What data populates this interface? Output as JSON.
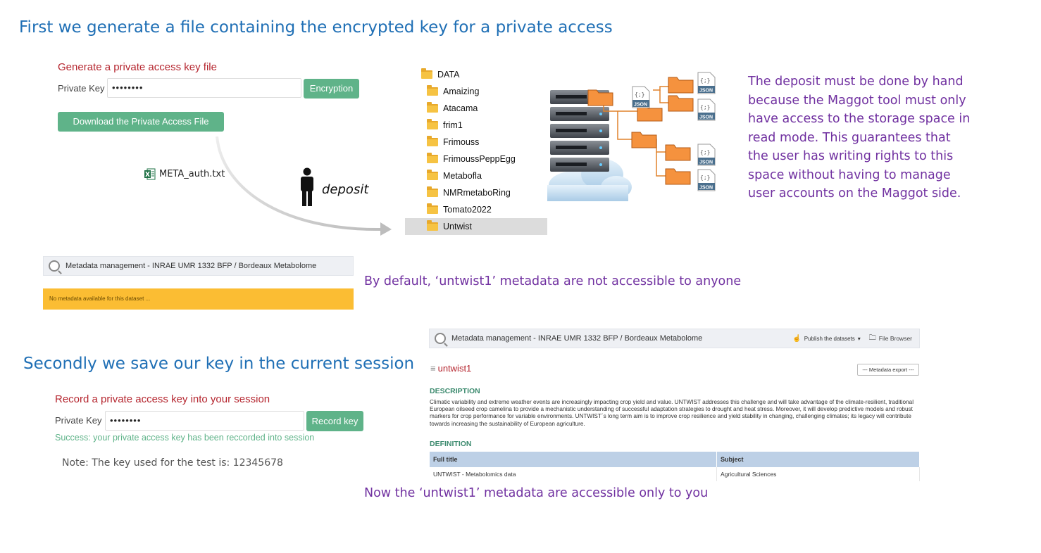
{
  "headings": {
    "first": "First we generate a file  containing the encrypted key for a private access",
    "second": "Secondly we save our key in the current session"
  },
  "generate_form": {
    "title": "Generate a private access key file",
    "key_label": "Private Key :",
    "key_value": "••••••••",
    "encrypt_button": "Encryption",
    "download_button": "Download the Private Access File"
  },
  "auth_file": {
    "name": "META_auth.txt",
    "icon": "excel-file-icon"
  },
  "deposit_label": "deposit",
  "explorer": {
    "root": "DATA",
    "folders": [
      "Amaizing",
      "Atacama",
      "frim1",
      "Frimouss",
      "FrimoussPeppEgg",
      "Metabofla",
      "NMRmetaboRing",
      "Tomato2022",
      "Untwist"
    ],
    "selected": "Untwist"
  },
  "diagram": {
    "json_label": "JSON",
    "json_glyph": "{;}"
  },
  "deposit_explanation": [
    "The deposit must be done by hand",
    "because the Maggot tool must only",
    "have access to the storage space in",
    "read mode. This guarantees that",
    "the user has writing rights to this",
    "space without having to manage",
    "user accounts on the Maggot side."
  ],
  "locked_view": {
    "app_title": "Metadata management - INRAE UMR 1332 BFP / Bordeaux Metabolome",
    "alert": "No metadata available for this dataset ...",
    "caption": "By default, ‘untwist1’ metadata are not accessible to anyone"
  },
  "record_form": {
    "title": "Record a private access key into your session",
    "key_label": "Private Key :",
    "key_value": "••••••••",
    "record_button": "Record key",
    "success": "Success: your private access key has been reccorded into session",
    "note": "Note: The key used for the test is: 12345678"
  },
  "unlocked_view": {
    "app_title": "Metadata management - INRAE UMR 1332 BFP / Bordeaux Metabolome",
    "publish_menu": "Publish the datasets",
    "file_browser": "File Browser",
    "dataset_name": "untwist1",
    "export_select": "--- Metadata export ---",
    "description_title": "DESCRIPTION",
    "description": "Climatic variability and extreme weather events are increasingly impacting crop yield and value. UNTWIST addresses this challenge and will take advantage of the climate-resilient, traditional European oilseed crop camelina to provide a mechanistic understanding of successful adaptation strategies to drought and heat stress. Moreover, it will develop predictive models and robust markers for crop performance for variable environments. UNTWIST´s long term aim is to improve crop resilience and yield stability in changing, challenging climates; its legacy will contribute towards increasing the sustainability of European agriculture.",
    "definition_title": "DEFINITION",
    "table": {
      "headers": [
        "Full title",
        "Subject"
      ],
      "row": [
        "UNTWIST - Metabolomics data",
        "Agricultural Sciences"
      ]
    },
    "caption": "Now the ‘untwist1’ metadata are accessible only to you"
  }
}
